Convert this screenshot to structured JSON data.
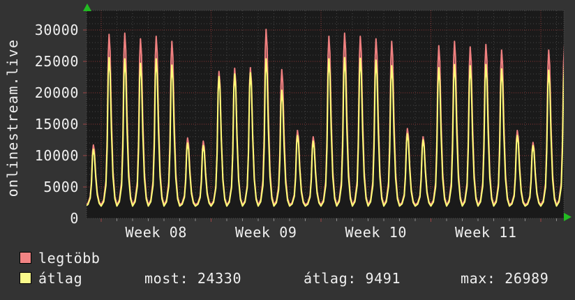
{
  "window": {
    "bg_color": "#333333",
    "plot_bg_color": "#1a1a1a",
    "grid_minor_color": "#454545",
    "grid_major_color": "#8b3434",
    "border_color": "#4f4f4f",
    "arrow_color": "#22bb22",
    "text_color": "#f0f0f0"
  },
  "vertical_title": "onlinestream.live",
  "chart_data": {
    "type": "line",
    "title": "onlinestream.live",
    "ylabel": "onlinestream.live",
    "xlabel": "",
    "ylim": [
      0,
      33000
    ],
    "y_ticks": [
      0,
      5000,
      10000,
      15000,
      20000,
      25000,
      30000
    ],
    "y_minor_step": 1000,
    "y_major_step": 5000,
    "x_week_labels": [
      "Week 08",
      "Week 09",
      "Week 10",
      "Week 11"
    ],
    "days_per_week": 7,
    "total_days": 31,
    "grid": true,
    "legend_position": "bottom-left",
    "series": [
      {
        "name": "legtöbb",
        "color": "#f08080",
        "band_fill": "rgba(240,128,128,0.38)",
        "base": 2150,
        "daily_peaks": [
          11700,
          29300,
          29500,
          28600,
          29000,
          28200,
          12800,
          12300,
          23400,
          23900,
          24000,
          30100,
          23700,
          14000,
          13000,
          29000,
          29500,
          29000,
          28600,
          28200,
          14300,
          13000,
          27500,
          28200,
          27300,
          27700,
          26800,
          14000,
          12100,
          26800,
          27500
        ]
      },
      {
        "name": "átlag",
        "color": "#ffff78",
        "base": 1950,
        "daily_peaks": [
          11000,
          25600,
          25400,
          24700,
          25400,
          24400,
          12000,
          11600,
          22600,
          23000,
          23200,
          25400,
          20400,
          13200,
          12300,
          25400,
          25600,
          25500,
          25200,
          24300,
          13500,
          12500,
          24000,
          24500,
          24300,
          24500,
          23800,
          13200,
          11600,
          23600,
          24300
        ]
      }
    ]
  },
  "legend": {
    "items": [
      {
        "label": "legtöbb",
        "color": "#f28484"
      },
      {
        "label": "átlag",
        "color": "#fbfb8b"
      }
    ]
  },
  "stats": [
    {
      "label": "most:",
      "value": "24330"
    },
    {
      "label": "átlag:",
      "value": "9491"
    },
    {
      "label": "max:",
      "value": "26989"
    }
  ],
  "icons": {
    "up_arrow": "y-axis-arrow",
    "right_arrow": "x-axis-arrow"
  }
}
